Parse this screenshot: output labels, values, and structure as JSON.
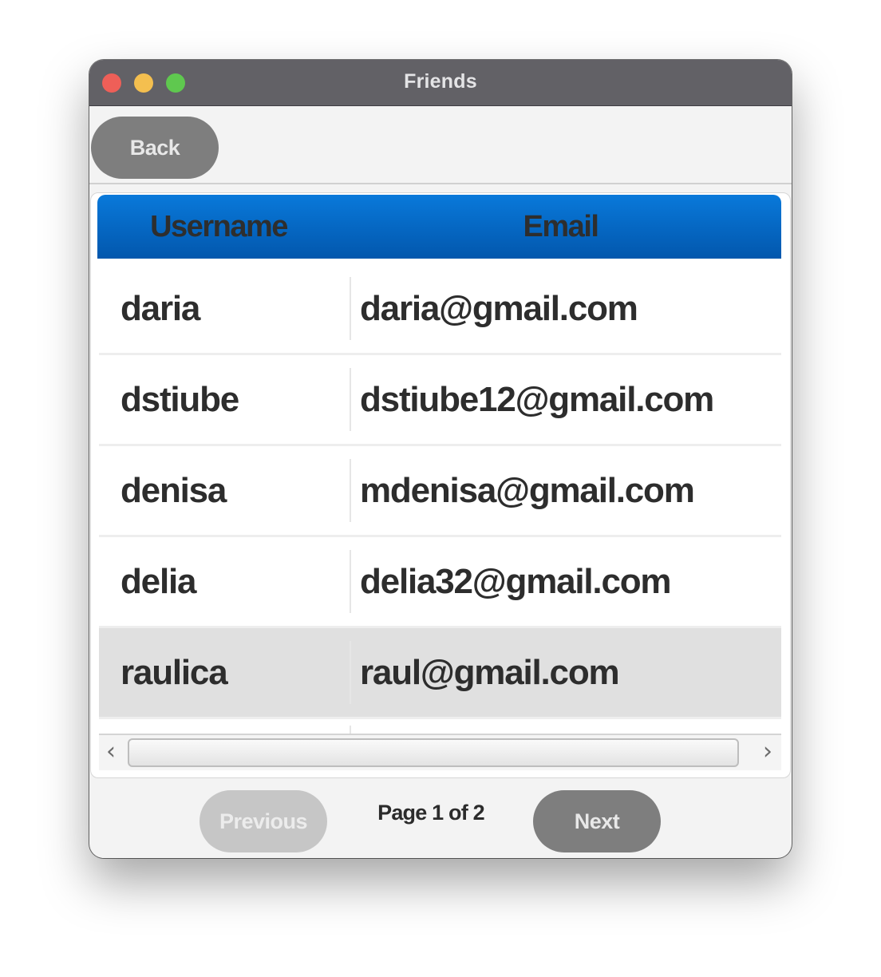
{
  "window": {
    "title": "Friends"
  },
  "toolbar": {
    "back_label": "Back"
  },
  "table": {
    "columns": [
      "Username",
      "Email"
    ],
    "rows": [
      {
        "username": "daria",
        "email": "daria@gmail.com"
      },
      {
        "username": "dstiube",
        "email": "dstiube12@gmail.com"
      },
      {
        "username": "denisa",
        "email": "mdenisa@gmail.com"
      },
      {
        "username": "delia",
        "email": "delia32@gmail.com"
      },
      {
        "username": "raulica",
        "email": "raul@gmail.com",
        "selected": true
      }
    ]
  },
  "scrollbar": {
    "left_icon": "chevron-left-icon",
    "right_icon": "chevron-right-icon"
  },
  "pager": {
    "previous_label": "Previous",
    "page_label": "Page 1 of 2",
    "next_label": "Next",
    "previous_enabled": false
  },
  "colors": {
    "header_gradient_top": "#0979da",
    "header_gradient_bottom": "#0257ad",
    "button": "#7e7e7e",
    "button_disabled": "#c6c6c6",
    "selected_row": "#e0e0e0"
  }
}
